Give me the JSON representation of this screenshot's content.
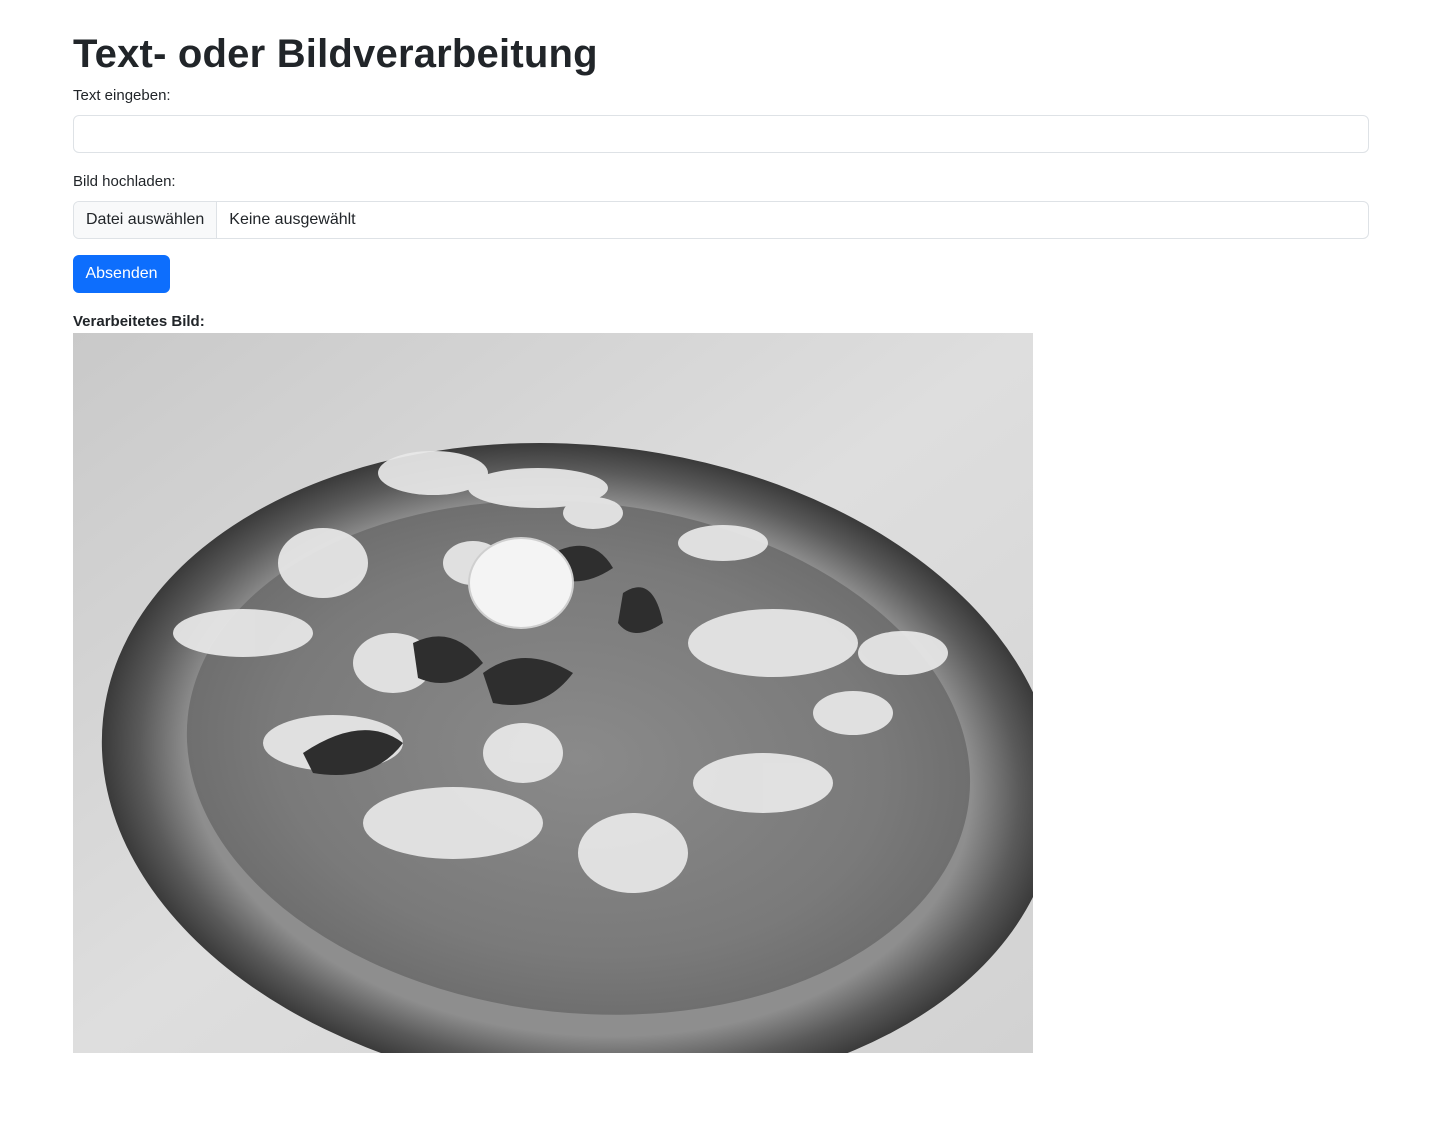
{
  "page": {
    "heading": "Text- oder Bildverarbeitung"
  },
  "form": {
    "text_label": "Text eingeben:",
    "text_value": "",
    "image_label": "Bild hochladen:",
    "file_button_label": "Datei auswählen",
    "file_status": "Keine ausgewählt",
    "submit_label": "Absenden",
    "submit_color": "#0d6efd"
  },
  "result": {
    "label": "Verarbeitetes Bild:",
    "image_subject": "pizza-image-grayscale"
  }
}
